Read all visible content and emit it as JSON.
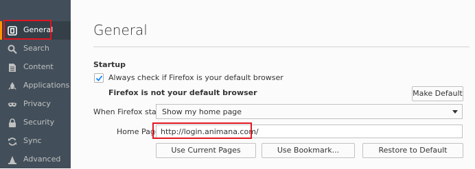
{
  "sidebar": {
    "items": [
      {
        "label": "General",
        "icon": "general-icon",
        "selected": true
      },
      {
        "label": "Search",
        "icon": "search-icon"
      },
      {
        "label": "Content",
        "icon": "content-icon"
      },
      {
        "label": "Applications",
        "icon": "applications-icon"
      },
      {
        "label": "Privacy",
        "icon": "privacy-mask-icon"
      },
      {
        "label": "Security",
        "icon": "lock-icon"
      },
      {
        "label": "Sync",
        "icon": "sync-icon"
      },
      {
        "label": "Advanced",
        "icon": "wizard-hat-icon"
      }
    ]
  },
  "main": {
    "title": "General",
    "startup": {
      "heading": "Startup",
      "default_check_label": "Always check if Firefox is your default browser",
      "default_checked": true,
      "not_default_text": "Firefox is not your default browser",
      "make_default_label": "Make Default",
      "when_starts_label": "When Firefox starts:",
      "when_starts_value": "Show my home page",
      "home_page_label": "Home Page:",
      "home_page_value": "http://login.animana.com/",
      "use_current_label": "Use Current Pages",
      "use_bookmark_label": "Use Bookmark...",
      "restore_default_label": "Restore to Default"
    }
  },
  "colors": {
    "sidebar_bg": "#424f5a",
    "selected_bg": "#343f48",
    "accent": "#ff9500",
    "highlight_box": "#e2141f",
    "checkmark": "#0a84ff"
  }
}
